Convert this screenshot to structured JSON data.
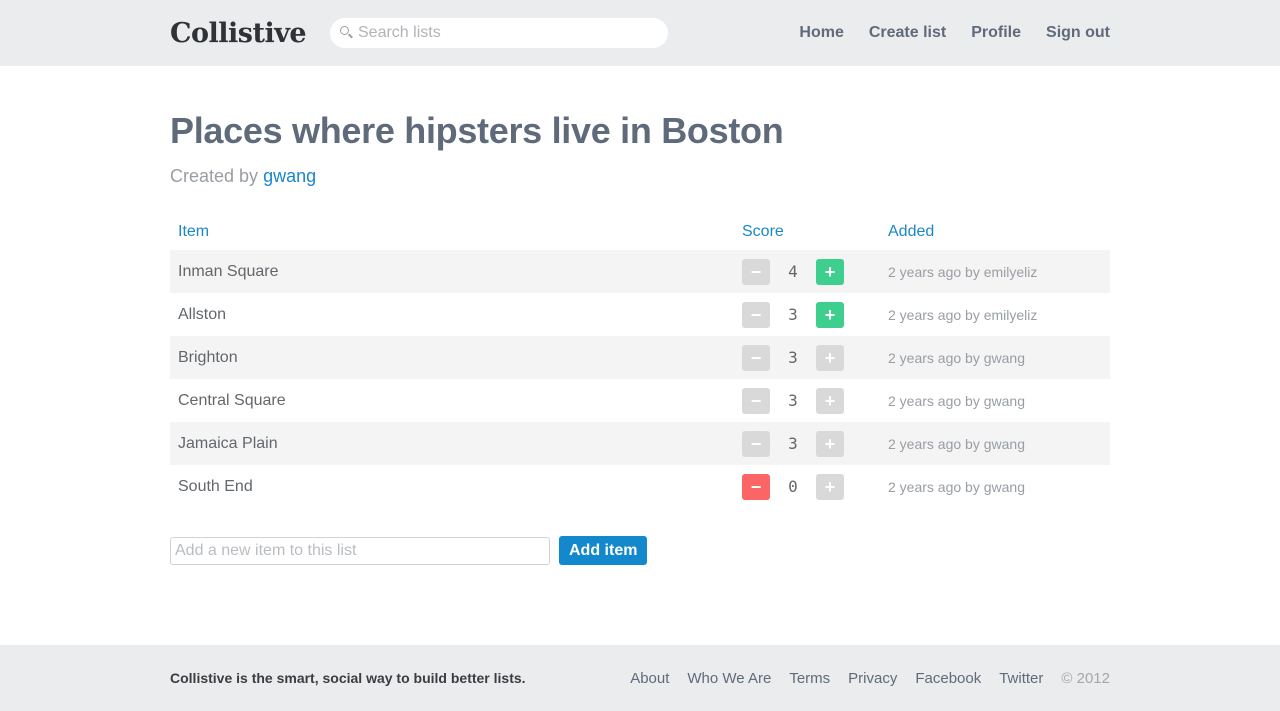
{
  "header": {
    "logo": "Collistive",
    "search_placeholder": "Search lists",
    "nav": [
      "Home",
      "Create list",
      "Profile",
      "Sign out"
    ]
  },
  "list": {
    "title": "Places where hipsters live in Boston",
    "created_by_prefix": "Created by",
    "creator": "gwang"
  },
  "table": {
    "columns": [
      "Item",
      "Score",
      "Added"
    ],
    "rows": [
      {
        "item": "Inman Square",
        "score": "4",
        "added": "2 years ago by emilyeliz",
        "vote": "up"
      },
      {
        "item": "Allston",
        "score": "3",
        "added": "2 years ago by emilyeliz",
        "vote": "up"
      },
      {
        "item": "Brighton",
        "score": "3",
        "added": "2 years ago by gwang",
        "vote": "none"
      },
      {
        "item": "Central Square",
        "score": "3",
        "added": "2 years ago by gwang",
        "vote": "none"
      },
      {
        "item": "Jamaica Plain",
        "score": "3",
        "added": "2 years ago by gwang",
        "vote": "none"
      },
      {
        "item": "South End",
        "score": "0",
        "added": "2 years ago by gwang",
        "vote": "down"
      }
    ],
    "minus_glyph": "−",
    "plus_glyph": "+"
  },
  "add_item": {
    "placeholder": "Add a new item to this list",
    "button_label": "Add item"
  },
  "footer": {
    "tagline": "Collistive is the smart, social way to build better lists.",
    "links": [
      "About",
      "Who We Are",
      "Terms",
      "Privacy",
      "Facebook",
      "Twitter"
    ],
    "copyright": "© 2012"
  },
  "colors": {
    "accent": "#1a87c9",
    "upvote": "#3ecf8e",
    "downvote": "#fb6565",
    "neutral_vote": "#d9d9d9"
  }
}
